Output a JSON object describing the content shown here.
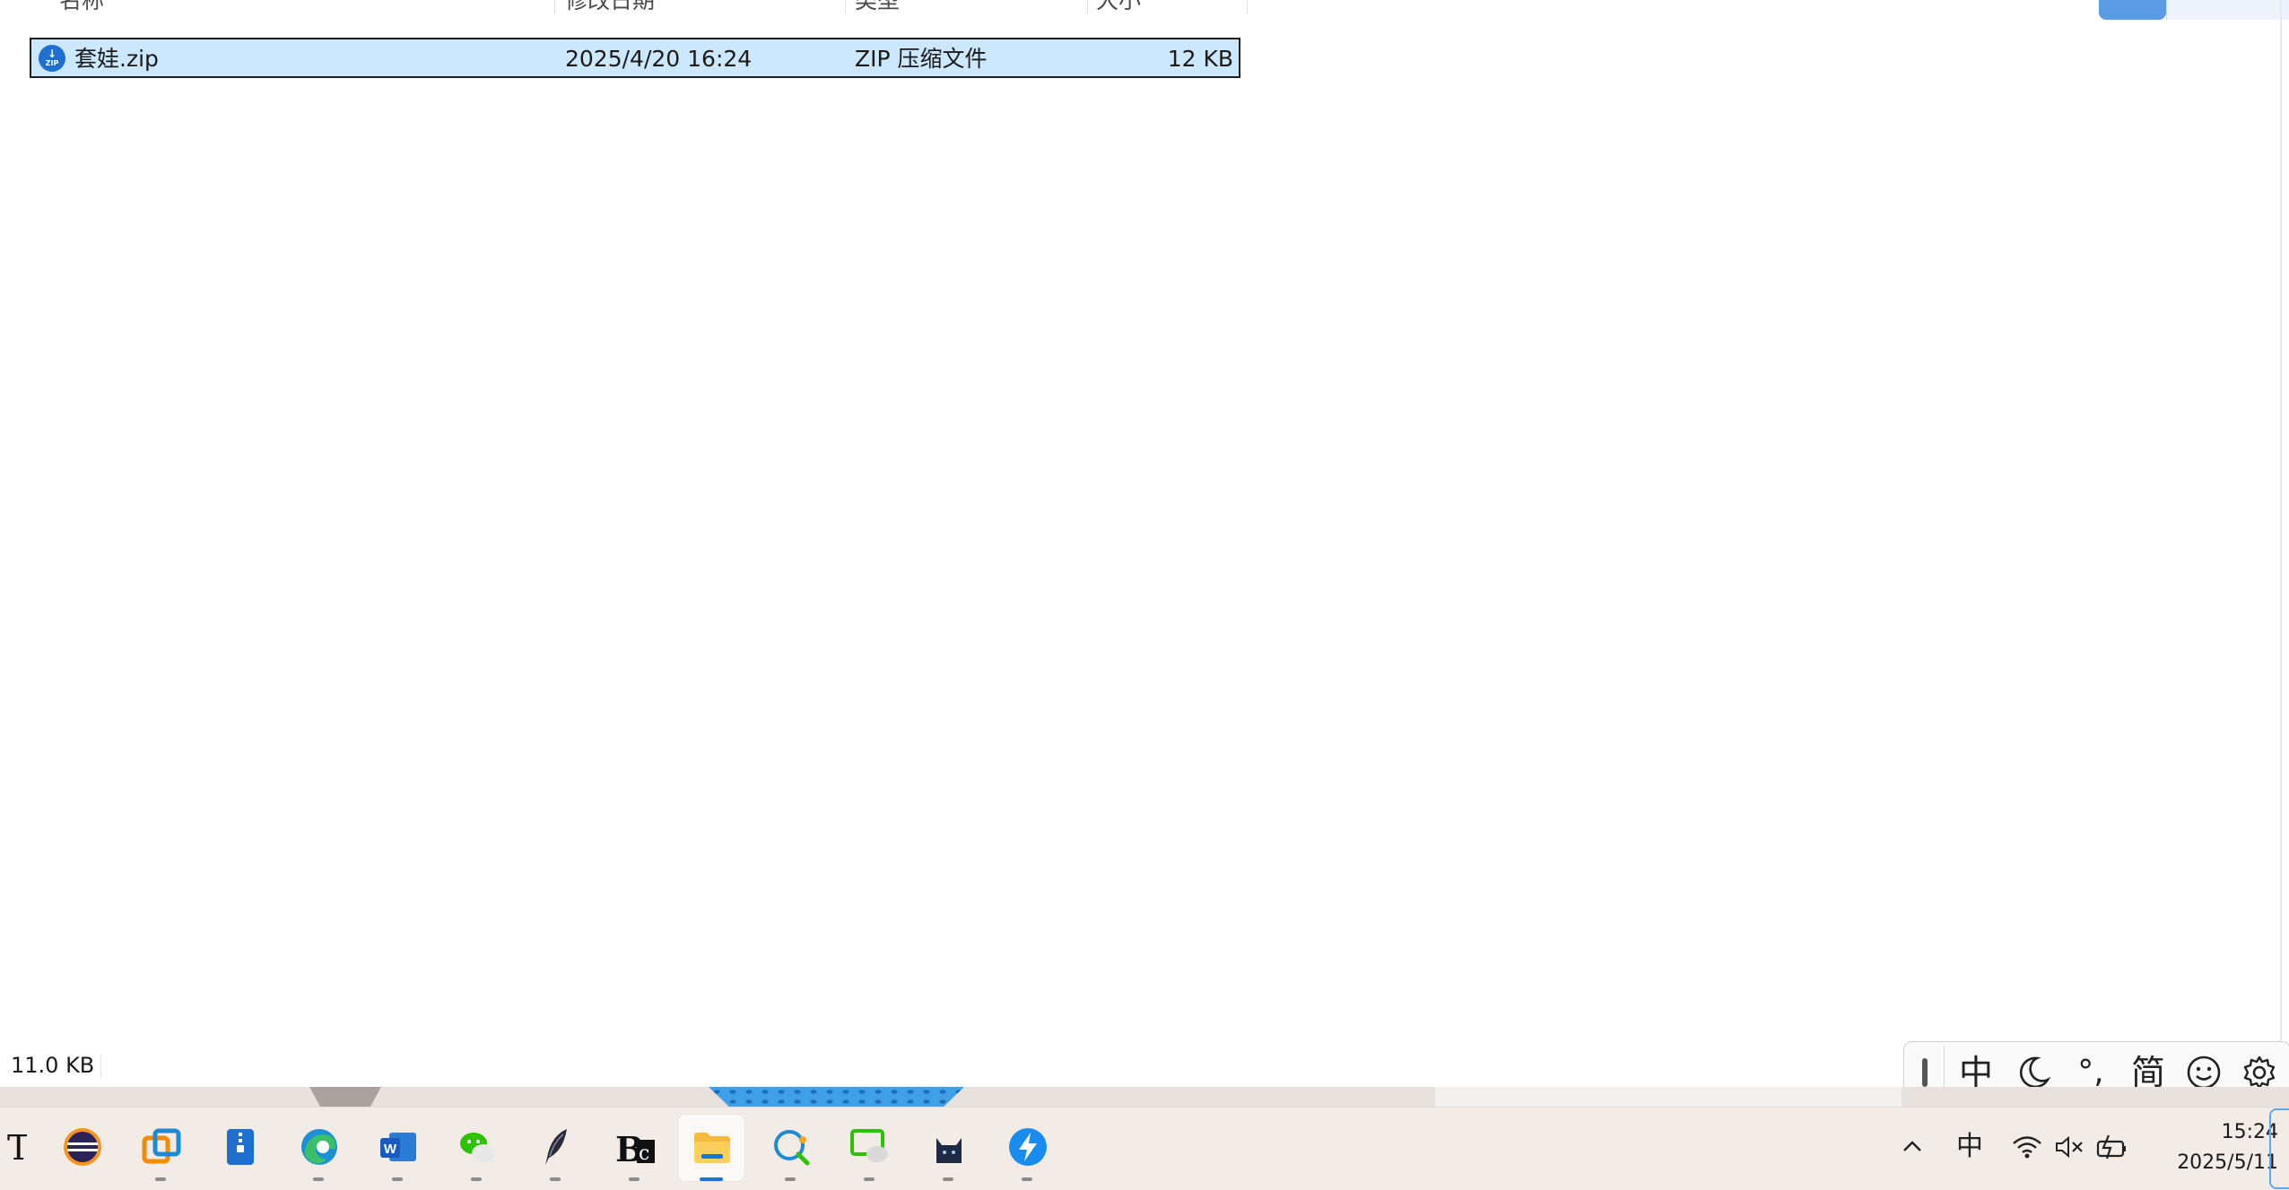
{
  "explorer": {
    "columns": {
      "name": "名称",
      "modified": "修改日期",
      "type": "类型",
      "size": "大小"
    },
    "files": [
      {
        "name": "套娃.zip",
        "modified": "2025/4/20 16:24",
        "type": "ZIP 压缩文件",
        "size": "12 KB",
        "icon": "zip-archive-icon",
        "selected": true
      }
    ],
    "status": {
      "selection_size": "11.0 KB"
    }
  },
  "ime_toolbar": {
    "lang": "中",
    "mode_icon": "moon-icon",
    "punct": "°,",
    "charset": "简",
    "emoji_icon": "smiley-icon",
    "settings_icon": "gear-icon"
  },
  "taskbar": {
    "apps": [
      {
        "name": "typora",
        "icon": "typora-icon"
      },
      {
        "name": "eclipse",
        "icon": "eclipse-icon"
      },
      {
        "name": "vmware",
        "icon": "vmware-icon"
      },
      {
        "name": "zip-app",
        "icon": "archive-app-icon"
      },
      {
        "name": "edge",
        "icon": "edge-icon"
      },
      {
        "name": "word",
        "icon": "word-icon"
      },
      {
        "name": "wechat",
        "icon": "wechat-icon"
      },
      {
        "name": "feather",
        "icon": "quill-icon"
      },
      {
        "name": "bc",
        "icon": "bc-icon"
      },
      {
        "name": "file-explorer",
        "icon": "folder-icon",
        "active": true
      },
      {
        "name": "search-app",
        "icon": "search-bubble-icon"
      },
      {
        "name": "screen-share",
        "icon": "monitor-chat-icon"
      },
      {
        "name": "cat-app",
        "icon": "cat-icon"
      },
      {
        "name": "bolt-app",
        "icon": "lightning-icon"
      }
    ],
    "tray": {
      "chevron_icon": "chevron-up-icon",
      "ime_lang": "中",
      "wifi_icon": "wifi-icon",
      "volume_icon": "volume-muted-icon",
      "battery_icon": "battery-charging-icon",
      "time": "15:24",
      "date": "2025/5/11"
    }
  }
}
